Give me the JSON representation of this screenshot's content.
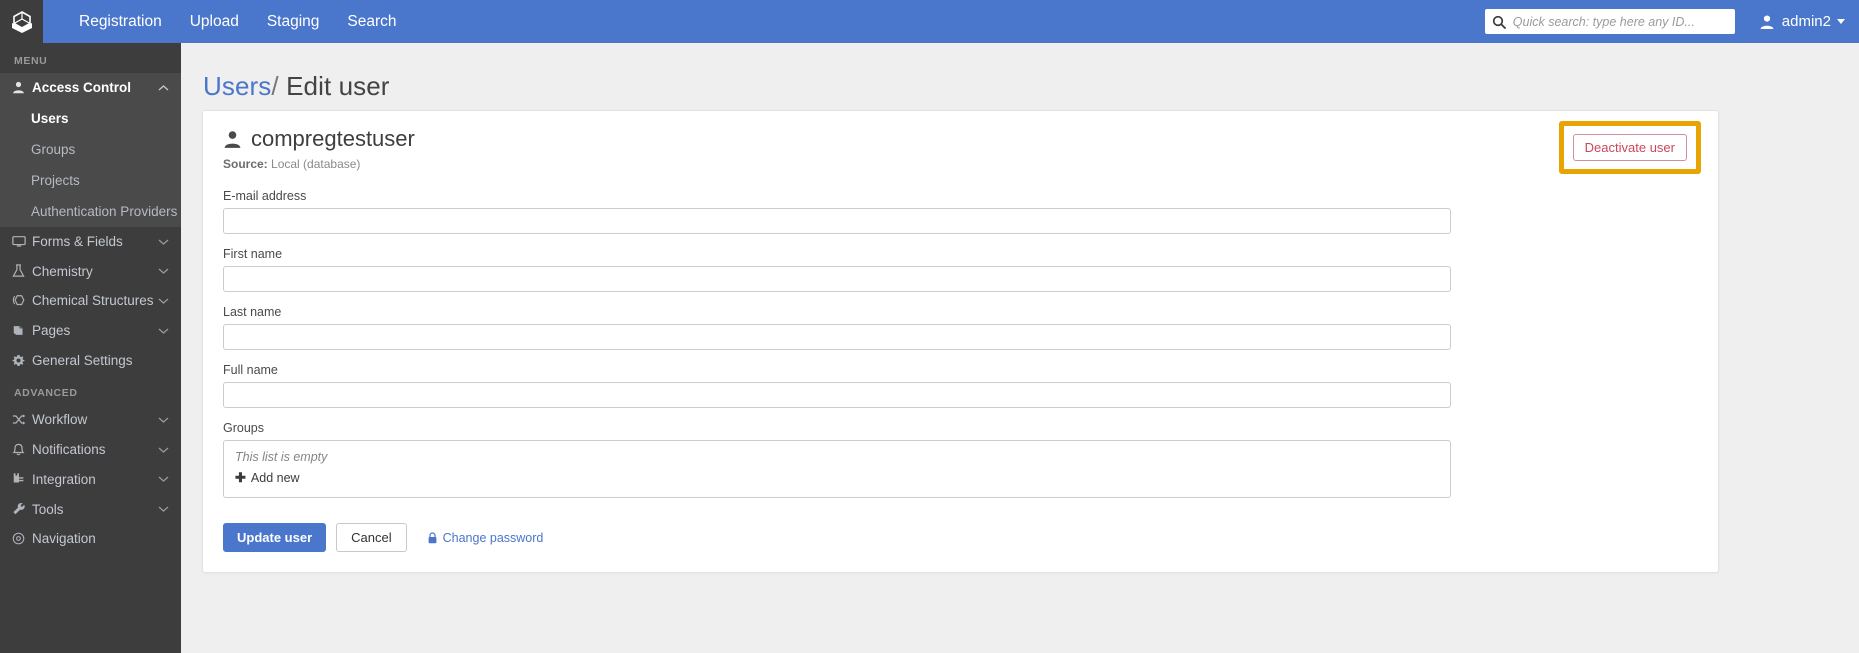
{
  "topbar": {
    "logo_icon": "cube-box-logo-icon",
    "nav": [
      {
        "label": "Registration"
      },
      {
        "label": "Upload"
      },
      {
        "label": "Staging"
      },
      {
        "label": "Search"
      }
    ],
    "search": {
      "icon": "search-icon",
      "placeholder": "Quick search: type here any ID...",
      "value": ""
    },
    "user": {
      "icon": "user-avatar-icon",
      "name": "admin2",
      "caret_icon": "chevron-down-icon"
    }
  },
  "sidebar": {
    "menu_heading": "MENU",
    "advanced_heading": "ADVANCED",
    "items": [
      {
        "label": "Access Control",
        "icon": "person-icon",
        "chevron": "chevron-up-icon",
        "expanded": true
      },
      {
        "label": "Forms & Fields",
        "icon": "monitor-icon",
        "chevron": "chevron-down-icon"
      },
      {
        "label": "Chemistry",
        "icon": "flask-icon",
        "chevron": "chevron-down-icon"
      },
      {
        "label": "Chemical Structures",
        "icon": "hexagon-structure-icon",
        "chevron": "chevron-down-icon"
      },
      {
        "label": "Pages",
        "icon": "book-icon",
        "chevron": "chevron-down-icon"
      },
      {
        "label": "General Settings",
        "icon": "gear-icon",
        "chevron": ""
      }
    ],
    "access_control_children": [
      {
        "label": "Users",
        "active": true
      },
      {
        "label": "Groups",
        "active": false
      },
      {
        "label": "Projects",
        "active": false
      },
      {
        "label": "Authentication Providers",
        "active": false
      }
    ],
    "advanced_items": [
      {
        "label": "Workflow",
        "icon": "shuffle-icon",
        "chevron": "chevron-down-icon"
      },
      {
        "label": "Notifications",
        "icon": "bell-icon",
        "chevron": "chevron-down-icon"
      },
      {
        "label": "Integration",
        "icon": "plug-icon",
        "chevron": "chevron-down-icon"
      },
      {
        "label": "Tools",
        "icon": "wrench-icon",
        "chevron": "chevron-down-icon"
      },
      {
        "label": "Navigation",
        "icon": "compass-icon",
        "chevron": ""
      }
    ]
  },
  "breadcrumb": {
    "parent": "Users",
    "separator": "/",
    "current": "Edit user"
  },
  "card": {
    "title": "compregtestuser",
    "title_icon": "person-icon",
    "source_label": "Source:",
    "source_value": "Local (database)",
    "deactivate_label": "Deactivate user",
    "highlight_color": "#e8a400",
    "deactivate_color": "#c9485b"
  },
  "form": {
    "fields": [
      {
        "label": "E-mail address",
        "value": "",
        "name": "email-field"
      },
      {
        "label": "First name",
        "value": "",
        "name": "first-name-field"
      },
      {
        "label": "Last name",
        "value": "",
        "name": "last-name-field"
      },
      {
        "label": "Full name",
        "value": "",
        "name": "full-name-field"
      }
    ],
    "groups": {
      "label": "Groups",
      "empty_text": "This list is empty",
      "add_new_label": "Add new",
      "plus_icon": "plus-icon"
    },
    "buttons": {
      "update": "Update user",
      "cancel": "Cancel",
      "change_password": "Change password",
      "lock_icon": "lock-icon"
    }
  },
  "colors": {
    "brand_blue": "#4a76cb",
    "sidebar_dark": "#3d3d3d",
    "page_bg": "#efefef"
  }
}
